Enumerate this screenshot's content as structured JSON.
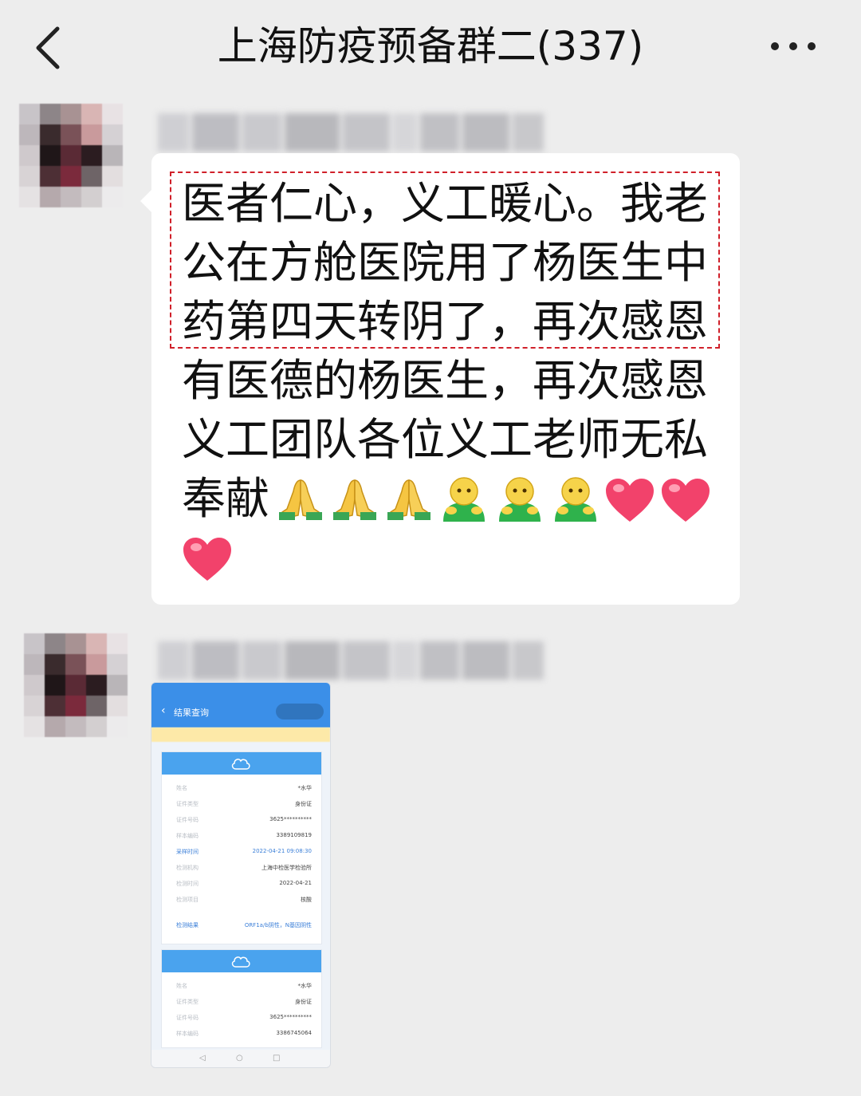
{
  "header": {
    "title": "上海防疫预备群二(337)",
    "back_icon": "chevron-left-icon",
    "more_icon": "more-dots-icon"
  },
  "messages": [
    {
      "type": "text",
      "text": "医者仁心，义工暖心。我老公在方舱医院用了杨医生中药第四天转阴了，再次感恩有医德的杨医生，再次感恩义工团队各位义工老师无私奉献",
      "emojis": [
        "folded-hands-icon",
        "folded-hands-icon",
        "folded-hands-icon",
        "person-icon",
        "person-icon",
        "person-icon",
        "heart-icon",
        "heart-icon",
        "heart-icon"
      ],
      "highlight_color": "#d0202a"
    },
    {
      "type": "image",
      "screenshot": {
        "header_title": "结果查询",
        "card1": {
          "rows": [
            {
              "k": "姓名",
              "v": "*水华"
            },
            {
              "k": "证件类型",
              "v": "身份证"
            },
            {
              "k": "证件号码",
              "v": "3625**********"
            },
            {
              "k": "样本编码",
              "v": "3389109819"
            },
            {
              "k": "采样时间",
              "v": "2022-04-21 09:08:30"
            },
            {
              "k": "检测机构",
              "v": "上海中检医学检验所"
            },
            {
              "k": "检测时间",
              "v": "2022-04-21"
            },
            {
              "k": "检测项目",
              "v": "核酸"
            }
          ],
          "result": {
            "k": "检测结果",
            "v": "ORF1a/b阴性，N基因阴性"
          }
        },
        "card2": {
          "rows": [
            {
              "k": "姓名",
              "v": "*水华"
            },
            {
              "k": "证件类型",
              "v": "身份证"
            },
            {
              "k": "证件号码",
              "v": "3625**********"
            },
            {
              "k": "样本编码",
              "v": "3386745064"
            }
          ]
        }
      }
    }
  ],
  "colors": {
    "background": "#ededed",
    "bubble": "#ffffff",
    "accent_blue": "#3b8fe8"
  }
}
